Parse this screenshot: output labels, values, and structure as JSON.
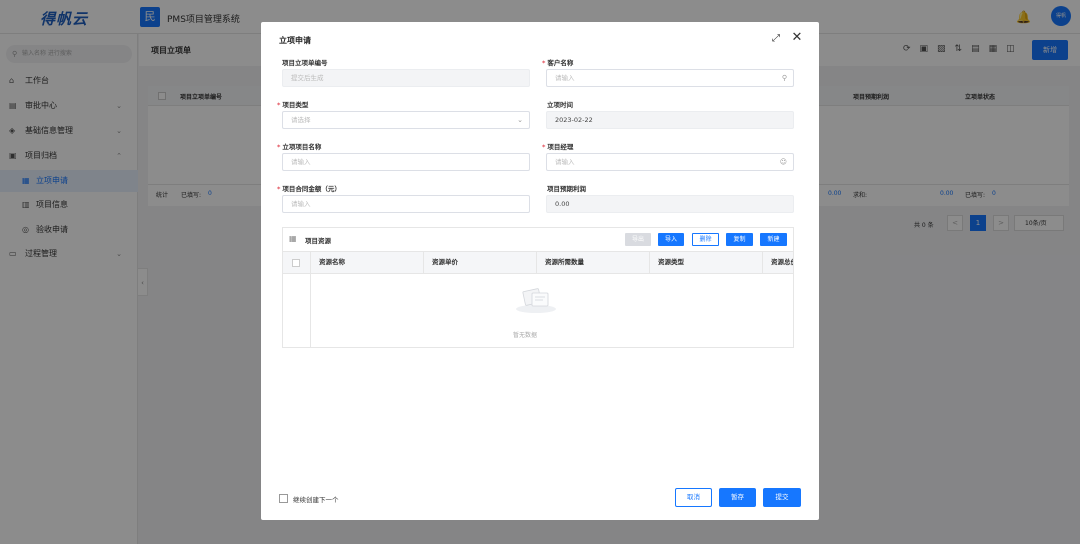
{
  "app": {
    "logo": "得帆云",
    "system_icon": "民",
    "system_name": "PMS项目管理系统",
    "avatar_text": "得帆"
  },
  "sidebar": {
    "search_placeholder": "输入名称 进行搜索",
    "items": [
      {
        "label": "工作台",
        "icon": "home-icon"
      },
      {
        "label": "审批中心",
        "icon": "approval-icon"
      },
      {
        "label": "基础信息管理",
        "icon": "layers-icon"
      },
      {
        "label": "项目归档",
        "icon": "archive-icon"
      },
      {
        "label": "立项申请",
        "icon": "form-icon"
      },
      {
        "label": "项目信息",
        "icon": "document-icon"
      },
      {
        "label": "验收申请",
        "icon": "check-icon"
      },
      {
        "label": "过程管理",
        "icon": "folder-icon"
      }
    ]
  },
  "main": {
    "title": "项目立项单",
    "new_button": "新增",
    "columns": [
      "项目立项单编号",
      "项目预期利润",
      "立项单状态"
    ],
    "footer": {
      "stat": "统计",
      "filled_label": "已填写:",
      "filled_value": "0",
      "amount1": "0.00",
      "sum_label": "求和:",
      "amount2": "0.00",
      "filled_label2": "已填写:",
      "filled_value2": "0"
    },
    "pager": {
      "total": "共 0 条",
      "prev": "<",
      "page": "1",
      "next": ">",
      "page_size": "10条/页"
    }
  },
  "modal": {
    "title": "立项申请",
    "fields": {
      "code": {
        "label": "项目立项单编号",
        "placeholder": "提交后生成"
      },
      "customer": {
        "label": "客户名称",
        "placeholder": "请输入"
      },
      "type": {
        "label": "项目类型",
        "placeholder": "请选择"
      },
      "time": {
        "label": "立项时间",
        "value": "2023-02-22"
      },
      "name": {
        "label": "立项项目名称",
        "placeholder": "请输入"
      },
      "manager": {
        "label": "项目经理",
        "placeholder": "请输入"
      },
      "amount": {
        "label": "项目合同金额（元）",
        "placeholder": "请输入"
      },
      "profit": {
        "label": "项目预期利润",
        "value": "0.00"
      }
    },
    "resources": {
      "title": "项目资源",
      "buttons": {
        "export": "导出",
        "import": "导入",
        "delete": "删除",
        "copy": "复制",
        "new": "新建"
      },
      "columns": [
        "资源名称",
        "资源单价",
        "资源所需数量",
        "资源类型",
        "资源总价"
      ],
      "empty": "暂无数据"
    },
    "footer": {
      "continue_label": "继续创建下一个",
      "cancel": "取消",
      "save_draft": "暂存",
      "submit": "提交"
    }
  },
  "colors": {
    "primary": "#1677ff",
    "required": "#e34d59"
  }
}
